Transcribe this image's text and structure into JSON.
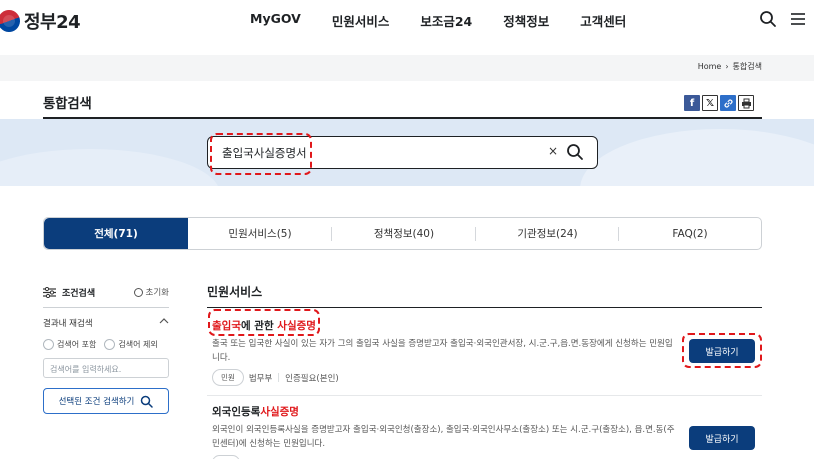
{
  "header": {
    "logo_text": "정부24",
    "nav": [
      "MyGOV",
      "민원서비스",
      "보조금24",
      "정책정보",
      "고객센터"
    ],
    "icons": [
      "search-icon",
      "menu-icon"
    ]
  },
  "breadcrumb": {
    "home": "Home",
    "current": "통합검색"
  },
  "page": {
    "title": "통합검색",
    "share_icons": [
      "facebook-icon",
      "x-icon",
      "link-icon",
      "print-icon"
    ]
  },
  "search": {
    "value": "출입국사실증명서",
    "clear": "×"
  },
  "tabs": [
    {
      "label": "전체(71)",
      "active": true
    },
    {
      "label": "민원서비스(5)"
    },
    {
      "label": "정책정보(40)"
    },
    {
      "label": "기관정보(24)"
    },
    {
      "label": "FAQ(2)"
    }
  ],
  "filter": {
    "title": "조건검색",
    "reset": "초기화",
    "within_title": "결과내 재검색",
    "include": "검색어 포함",
    "exclude": "검색어 제외",
    "placeholder": "검색어를 입력하세요.",
    "apply": "선택된 조건 검색하기"
  },
  "results": {
    "section_title": "민원서비스",
    "items": [
      {
        "title_pre": "출입국",
        "title_mid": "에 관한 ",
        "title_hl": "사실증명",
        "desc": "출국 또는 입국한 사실이 있는 자가 그의 출입국 사실을 증명받고자 출입국·외국인관서장, 시.군.구,읍.면.동장에게 신청하는 민원입니다.",
        "tag": "민원",
        "agency": "법무부",
        "auth": "인증필요(본인)",
        "button": "발급하기"
      },
      {
        "title_pre": "외국인등록",
        "title_hl": "사실증명",
        "desc": "외국인이 외국인등록사실을 증명받고자 출입국·외국인청(출장소), 출입국·외국인사무소(출장소) 또는 시.군.구(출장소), 읍.면.동(주민센터)에 신청하는 민원입니다.",
        "button": "발급하기"
      }
    ]
  },
  "colors": {
    "primary": "#0b3d7c",
    "highlight": "#e0181b",
    "band": "#dde8f5"
  }
}
